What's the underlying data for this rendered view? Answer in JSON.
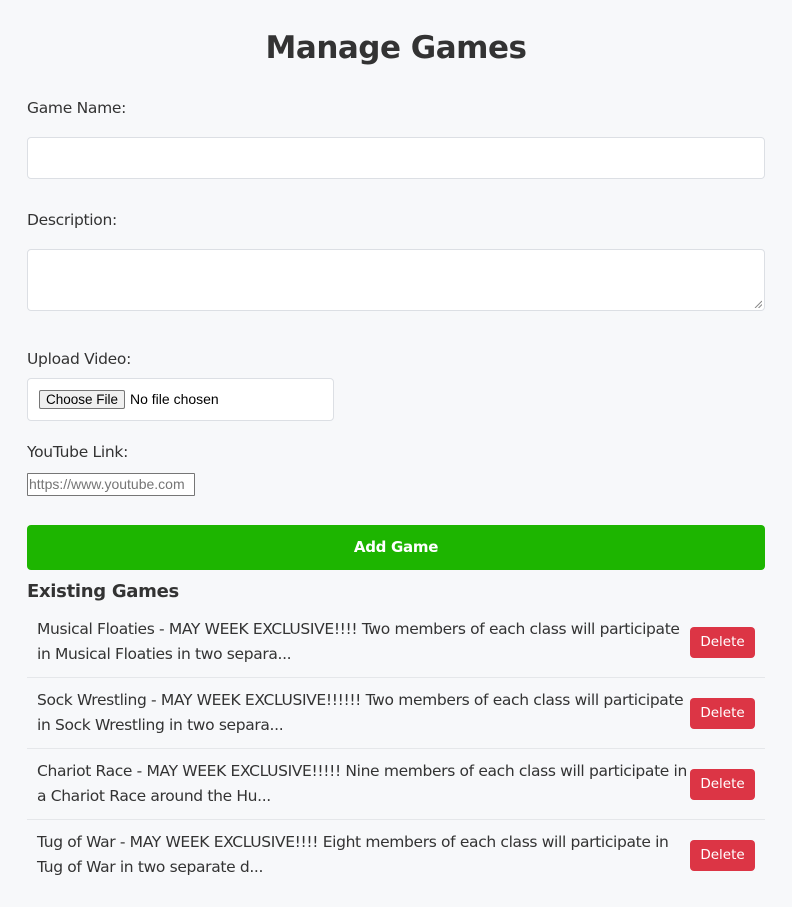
{
  "page": {
    "title": "Manage Games"
  },
  "form": {
    "game_name_label": "Game Name:",
    "game_name_value": "",
    "description_label": "Description:",
    "description_value": "",
    "upload_label": "Upload Video:",
    "choose_file_label": "Choose File",
    "no_file_text": "No file chosen",
    "youtube_label": "YouTube Link:",
    "youtube_placeholder": "https://www.youtube.com",
    "add_button_label": "Add Game"
  },
  "existing": {
    "heading": "Existing Games",
    "items": [
      {
        "text": "Musical Floaties - MAY WEEK EXCLUSIVE!!!! Two members of each class will participate in Musical Floaties in two separa...",
        "delete_label": "Delete"
      },
      {
        "text": "Sock Wrestling - MAY WEEK EXCLUSIVE!!!!!! Two members of each class will participate in Sock Wrestling in two separa...",
        "delete_label": "Delete"
      },
      {
        "text": "Chariot Race - MAY WEEK EXCLUSIVE!!!!! Nine members of each class will participate in a Chariot Race around the Hu...",
        "delete_label": "Delete"
      },
      {
        "text": "Tug of War - MAY WEEK EXCLUSIVE!!!! Eight members of each class will participate in Tug of War in two separate d...",
        "delete_label": "Delete"
      }
    ]
  },
  "colors": {
    "accent_green": "#1db500",
    "delete_red": "#dc3545",
    "background": "#f7f8fa",
    "text": "#333333"
  }
}
